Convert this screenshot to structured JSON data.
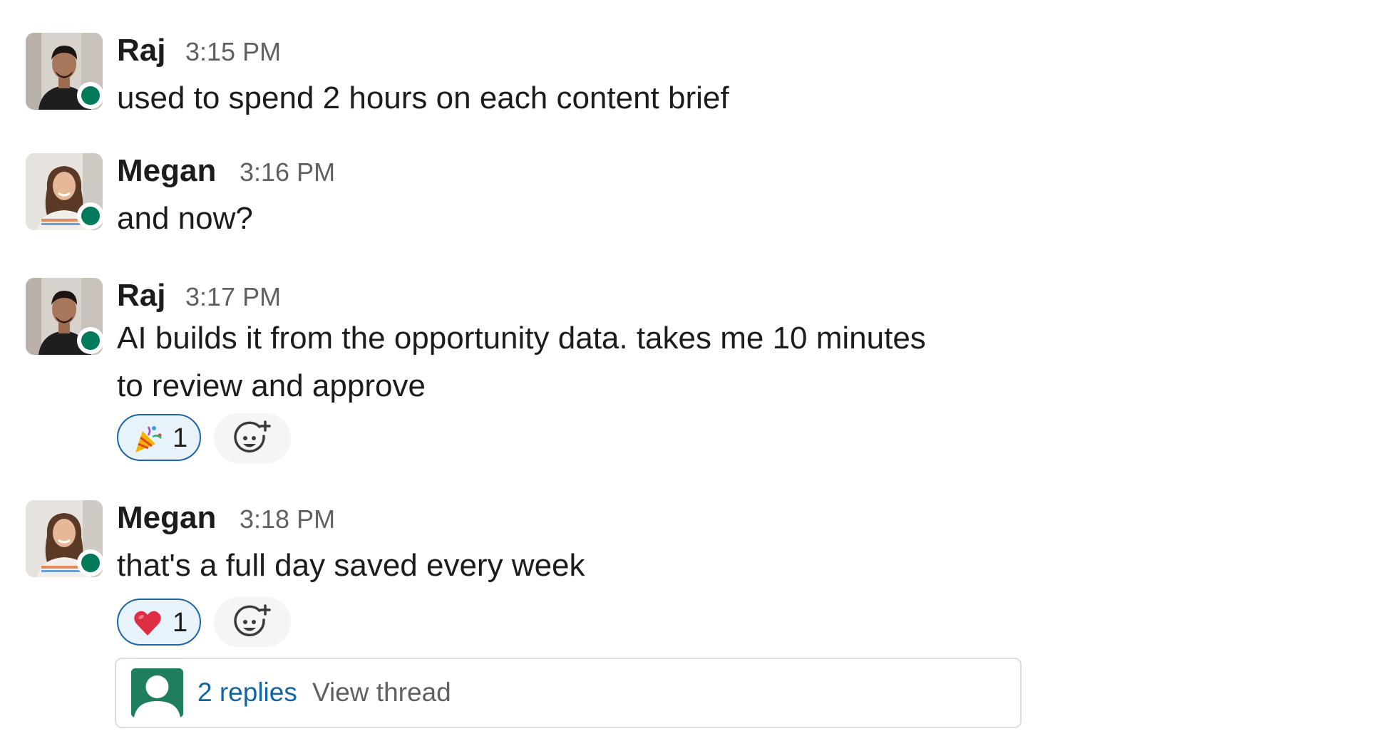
{
  "messages": [
    {
      "author": "Raj",
      "time": "3:15 PM",
      "lines": [
        "used to spend 2 hours on each content brief"
      ],
      "avatar_icon": "raj-profile-photo",
      "presence": "active"
    },
    {
      "author": "Megan",
      "time": "3:16 PM",
      "lines": [
        "and now?"
      ],
      "avatar_icon": "megan-profile-photo",
      "presence": "active"
    },
    {
      "author": "Raj",
      "time": "3:17 PM",
      "lines": [
        "AI builds it from the opportunity data. takes me 10 minutes",
        "to review and approve"
      ],
      "avatar_icon": "raj-profile-photo",
      "presence": "active",
      "reaction": {
        "emoji_icon": "party-popper-emoji",
        "count": "1"
      }
    },
    {
      "author": "Megan",
      "time": "3:18 PM",
      "lines": [
        "that's a full day saved every week"
      ],
      "avatar_icon": "megan-profile-photo",
      "presence": "active",
      "reaction": {
        "emoji_icon": "red-heart-emoji",
        "count": "1"
      }
    }
  ],
  "add_reaction_icon": "add-reaction-icon",
  "thread": {
    "replies_label": "2 replies",
    "view_label": "View thread",
    "avatar_icon": "default-user-avatar"
  },
  "colors": {
    "presence": "#007a5a",
    "link": "#1264a3",
    "reaction_border": "#1d64a8",
    "reaction_bg": "#e8f2fb"
  }
}
